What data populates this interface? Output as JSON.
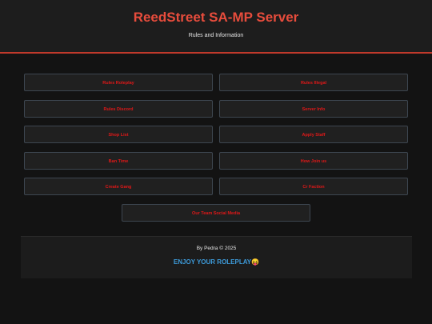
{
  "header": {
    "title": "ReedStreet SA-MP Server",
    "subtitle": "Rules and Information"
  },
  "buttons": {
    "rules_roleplay": "Rules Roleplay",
    "rules_illegal": "Rules Illegal",
    "rules_discord": "Rules Discord",
    "server_info": "Server Info",
    "shop_list": "Shop List",
    "apply_staff": "Apply Staff",
    "ban_time": "Ban Time",
    "how_join": "How Join us",
    "create_gang": "Create Gang",
    "cr_faction": "Cr Faction",
    "team_social": "Our Team Social Media"
  },
  "footer": {
    "credit": "By Pedra © 2025",
    "tagline": "ENJOY YOUR ROLEPLAY😝"
  },
  "colors": {
    "accent": "#e74c3c",
    "button_text": "#e01818",
    "tagline": "#3d9ad9",
    "background": "#131313"
  }
}
